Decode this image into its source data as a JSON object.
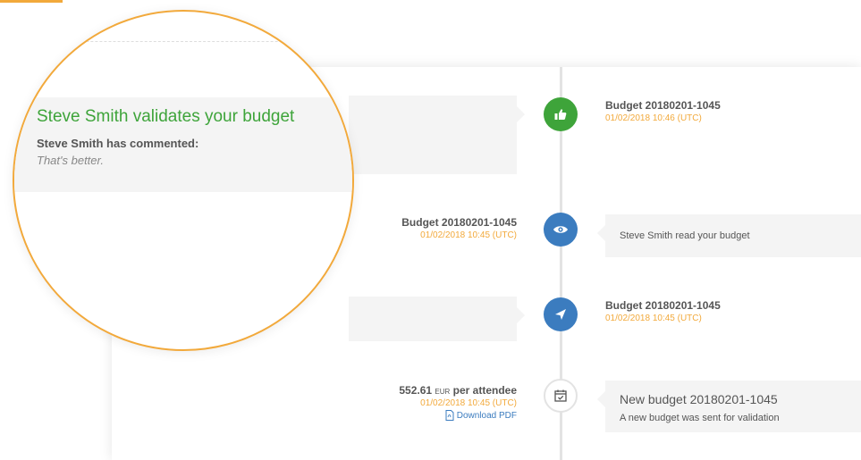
{
  "events": [
    {
      "node": "thumbs-up-icon",
      "node_color": "#3ea43a",
      "title": "Budget 20180201-1045",
      "time": "01/02/2018 10:46 (UTC)"
    },
    {
      "node": "eye-icon",
      "node_color": "#3b7cbf",
      "title": "Budget 20180201-1045",
      "time": "01/02/2018 10:45 (UTC)",
      "message": "Steve Smith read your budget"
    },
    {
      "node": "paper-plane-icon",
      "node_color": "#3b7cbf",
      "title": "Budget 20180201-1045",
      "time": "01/02/2018 10:45 (UTC)"
    },
    {
      "node": "calendar-check-icon",
      "price_value": "552.61",
      "price_currency": "EUR",
      "price_suffix": "per attendee",
      "time": "01/02/2018 10:45 (UTC)",
      "download_label": "Download PDF",
      "message_title": "New budget 20180201-1045",
      "message": "A new budget was sent for validation"
    }
  ],
  "zoom": {
    "title": "Steve Smith validates your budget",
    "commented": "Steve Smith has commented:",
    "comment": "That's better."
  },
  "colors": {
    "accent": "#f2a93b",
    "success": "#3ea43a",
    "primary": "#3b7cbf"
  }
}
